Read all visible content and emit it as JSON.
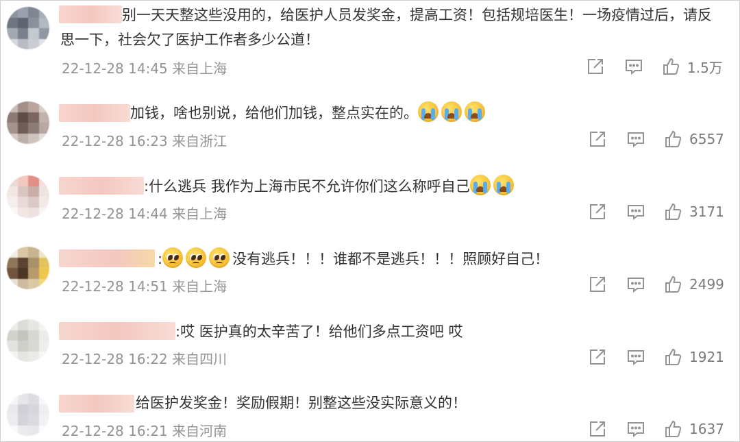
{
  "comments": [
    {
      "text": "别一天天整这些没用的，给医护人员发奖金，提高工资！包括规培医生！一场疫情过后，请反思一下，社会欠了医护工作者多少公道！",
      "time": "22-12-28 14:45",
      "location": "来自上海",
      "likes": "1.5万"
    },
    {
      "text": "加钱，啥也别说，给他们加钱，整点实在的。",
      "emojis": [
        "crying-emoji",
        "crying-emoji",
        "crying-emoji"
      ],
      "time": "22-12-28 16:23",
      "location": "来自浙江",
      "likes": "6557"
    },
    {
      "text": ":什么逃兵  我作为上海市民不允许你们这么称呼自己",
      "emojis": [
        "crying-emoji",
        "crying-emoji"
      ],
      "time": "22-12-28 14:44",
      "location": "来自上海",
      "likes": "3171"
    },
    {
      "prefix": ":",
      "emojis": [
        "pleading-emoji",
        "pleading-emoji",
        "pleading-emoji"
      ],
      "text": "没有逃兵！！！谁都不是逃兵！！！照顾好自己！",
      "time": "22-12-28 14:51",
      "location": "来自上海",
      "likes": "2499"
    },
    {
      "text": ":哎 医护真的太辛苦了！给他们多点工资吧 哎",
      "time": "22-12-28 16:22",
      "location": "来自四川",
      "likes": "1921"
    },
    {
      "text": "给医护发奖金！奖励假期！别整这些没实际意义的！",
      "time": "22-12-28 16:21",
      "location": "来自河南",
      "likes": "1637"
    }
  ],
  "icons": {
    "share": "share-icon",
    "comment": "comment-icon",
    "like": "thumbs-up-icon"
  },
  "colors": {
    "text": "#333333",
    "meta": "#939393",
    "icon": "#939393"
  }
}
